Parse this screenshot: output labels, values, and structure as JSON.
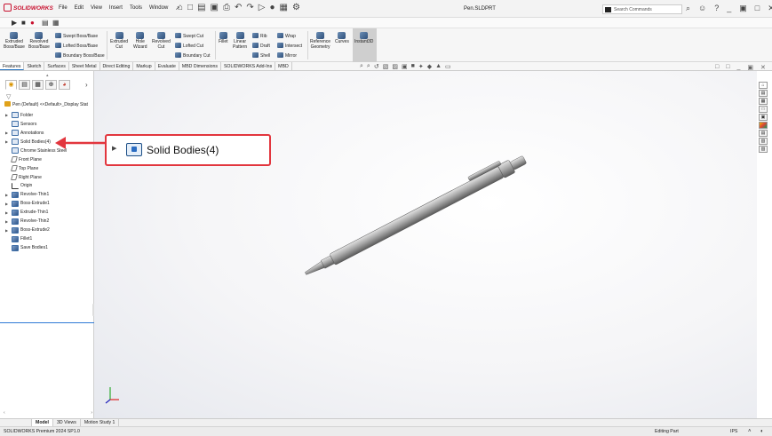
{
  "app": {
    "brand": "SOLIDWORKS",
    "doc_title": "Pen.SLDPRT"
  },
  "menu": [
    "File",
    "Edit",
    "View",
    "Insert",
    "Tools",
    "Window"
  ],
  "search": {
    "placeholder": "Search Commands"
  },
  "ribbon": {
    "extruded_boss": "Extruded\nBoss/Base",
    "revolved_boss": "Revolved\nBoss/Base",
    "swept_boss": "Swept Boss/Base",
    "lofted_boss": "Lofted Boss/Base",
    "boundary_boss": "Boundary Boss/Base",
    "extruded_cut": "Extruded\nCut",
    "hole_wizard": "Hole\nWizard",
    "revolved_cut": "Revolved\nCut",
    "swept_cut": "Swept Cut",
    "lofted_cut": "Lofted Cut",
    "boundary_cut": "Boundary Cut",
    "fillet": "Fillet",
    "linear_pattern": "Linear\nPattern",
    "rib": "Rib",
    "draft": "Draft",
    "shell": "Shell",
    "wrap": "Wrap",
    "intersect": "Intersect",
    "mirror": "Mirror",
    "reference_geometry": "Reference\nGeometry",
    "curves": "Curves",
    "instant3d": "Instant3D"
  },
  "command_tabs": [
    "Features",
    "Sketch",
    "Surfaces",
    "Sheet Metal",
    "Direct Editing",
    "Markup",
    "Evaluate",
    "MBD Dimensions",
    "SOLIDWORKS Add-Ins",
    "MBD"
  ],
  "feature_tree": {
    "root": "Pen (Default) <<Default>_Display Stat",
    "items": [
      {
        "label": "Folder",
        "expandable": true,
        "icon": "folder-icon"
      },
      {
        "label": "Sensors",
        "expandable": false,
        "icon": "sensor-icon"
      },
      {
        "label": "Annotations",
        "expandable": true,
        "icon": "annotation-icon"
      },
      {
        "label": "Solid Bodies(4)",
        "expandable": true,
        "icon": "solid-bodies-icon"
      },
      {
        "label": "Chrome Stainless Steel",
        "expandable": false,
        "icon": "material-icon"
      },
      {
        "label": "Front Plane",
        "expandable": false,
        "icon": "plane-icon"
      },
      {
        "label": "Top Plane",
        "expandable": false,
        "icon": "plane-icon"
      },
      {
        "label": "Right Plane",
        "expandable": false,
        "icon": "plane-icon"
      },
      {
        "label": "Origin",
        "expandable": false,
        "icon": "origin-icon"
      },
      {
        "label": "Revolve-Thin1",
        "expandable": true,
        "icon": "revolve-icon"
      },
      {
        "label": "Boss-Extrude1",
        "expandable": true,
        "icon": "extrude-icon"
      },
      {
        "label": "Extrude-Thin1",
        "expandable": true,
        "icon": "extrude-icon"
      },
      {
        "label": "Revolve-Thin2",
        "expandable": true,
        "icon": "revolve-icon"
      },
      {
        "label": "Boss-Extrude2",
        "expandable": true,
        "icon": "extrude-icon"
      },
      {
        "label": "Fillet1",
        "expandable": false,
        "icon": "fillet-icon"
      },
      {
        "label": "Save Bodies1",
        "expandable": false,
        "icon": "save-bodies-icon"
      }
    ]
  },
  "callout": {
    "label": "Solid Bodies(4)",
    "color": "#e2363e"
  },
  "bottom_tabs": [
    "Model",
    "3D Views",
    "Motion Study 1"
  ],
  "status": {
    "version": "SOLIDWORKS Premium 2024 SP1.0",
    "mode": "Editing Part",
    "units": "IPS"
  }
}
